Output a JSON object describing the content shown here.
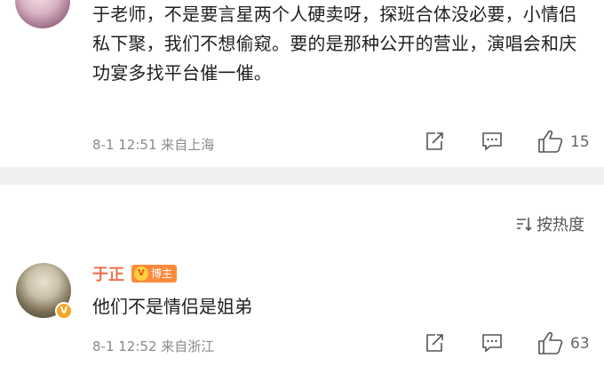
{
  "comments": [
    {
      "text": "于老师，不是要言星两个人硬卖呀，探班合体没必要，小情侣私下聚，我们不想偷窥。要的是那种公开的营业，演唱会和庆功宴多找平台催一催。",
      "time": "8-1 12:51",
      "location": "来自上海",
      "likes": "15",
      "icons": [
        "share-icon",
        "comment-icon",
        "like-icon"
      ]
    },
    {
      "username": "于正",
      "badge": "博主",
      "badge_icon_glyph": "V",
      "verified_glyph": "V",
      "text": "他们不是情侣是姐弟",
      "time": "8-1 12:52",
      "location": "来自浙江",
      "likes": "63",
      "icons": [
        "share-icon",
        "comment-icon",
        "like-icon"
      ]
    }
  ],
  "sort": {
    "label": "按热度",
    "icon": "sort-icon"
  },
  "colors": {
    "username": "#eb7350",
    "badge": "#ff8a3c",
    "meta": "#8a8a8a",
    "divider": "#f0f0f0"
  }
}
